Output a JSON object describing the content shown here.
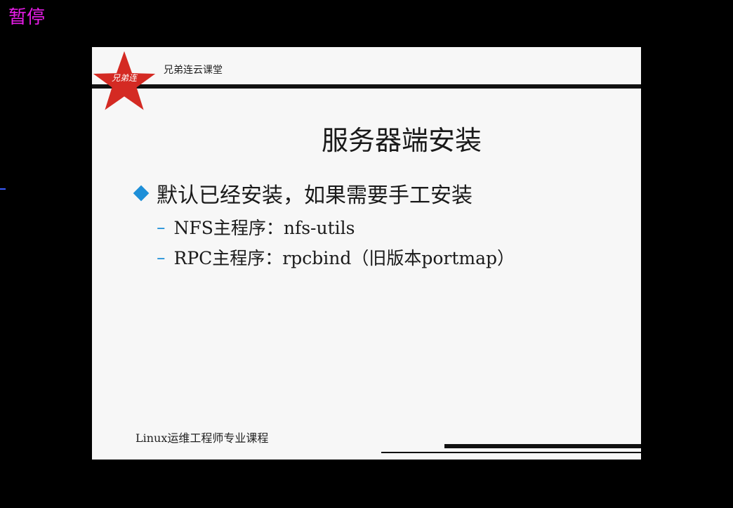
{
  "overlay": {
    "pause_label": "暂停"
  },
  "slide": {
    "brand": "兄弟连云课堂",
    "logo_text": "兄弟连",
    "title": "服务器端安装",
    "bullet": "默认已经安装，如果需要手工安装",
    "sub_items": [
      {
        "dash": "–",
        "text": "NFS主程序：nfs-utils"
      },
      {
        "dash": "–",
        "text": "RPC主程序：rpcbind（旧版本portmap）"
      }
    ],
    "footer": "Linux运维工程师专业课程"
  },
  "colors": {
    "background": "#000000",
    "slide_background": "#f7f7f7",
    "pause_label": "#e81ce8",
    "accent_blue": "#1e8fd8",
    "logo_red": "#d42a23"
  },
  "icons": {
    "logo": "red-star-icon",
    "bullet": "diamond-bullet-icon"
  }
}
